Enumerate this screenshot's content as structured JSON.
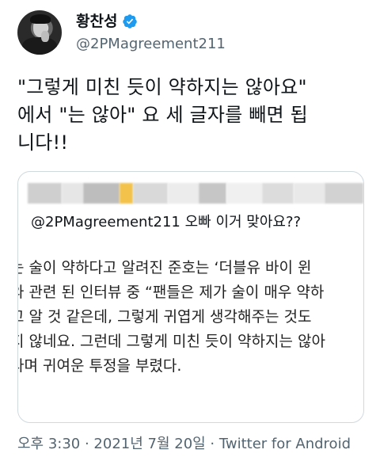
{
  "author": {
    "display_name": "황찬성",
    "handle": "@2PMagreement211",
    "verified_icon": "verified-badge-icon",
    "accent": "#1d9bf0"
  },
  "tweet": {
    "lines": [
      "\"그렇게 미친 듯이 약하지는 않아요\"",
      "에서 \"는 않아\" 요 세 글자를 빼면 됩",
      "니다!!"
    ]
  },
  "quoted": {
    "reply_to": "@2PMagreement211 오빠 이거 맞아요??",
    "body_lines": [
      "는 술이 약하다고 알려진 준호는 ‘더블유 바이 윈",
      "와 관련 된 인터뷰 중 “팬들은 제가 술이 매우 약하",
      "고 알 것 같은데, 그렇게 귀엽게 생각해주는 것도",
      "지 않네요. 그런데 그렇게 미친 듯이 약하지는 않아",
      "라며 귀여운 투정을 부렸다."
    ]
  },
  "meta": {
    "text": "오후 3:30 · 2021년 7월 20일 · Twitter for Android"
  }
}
